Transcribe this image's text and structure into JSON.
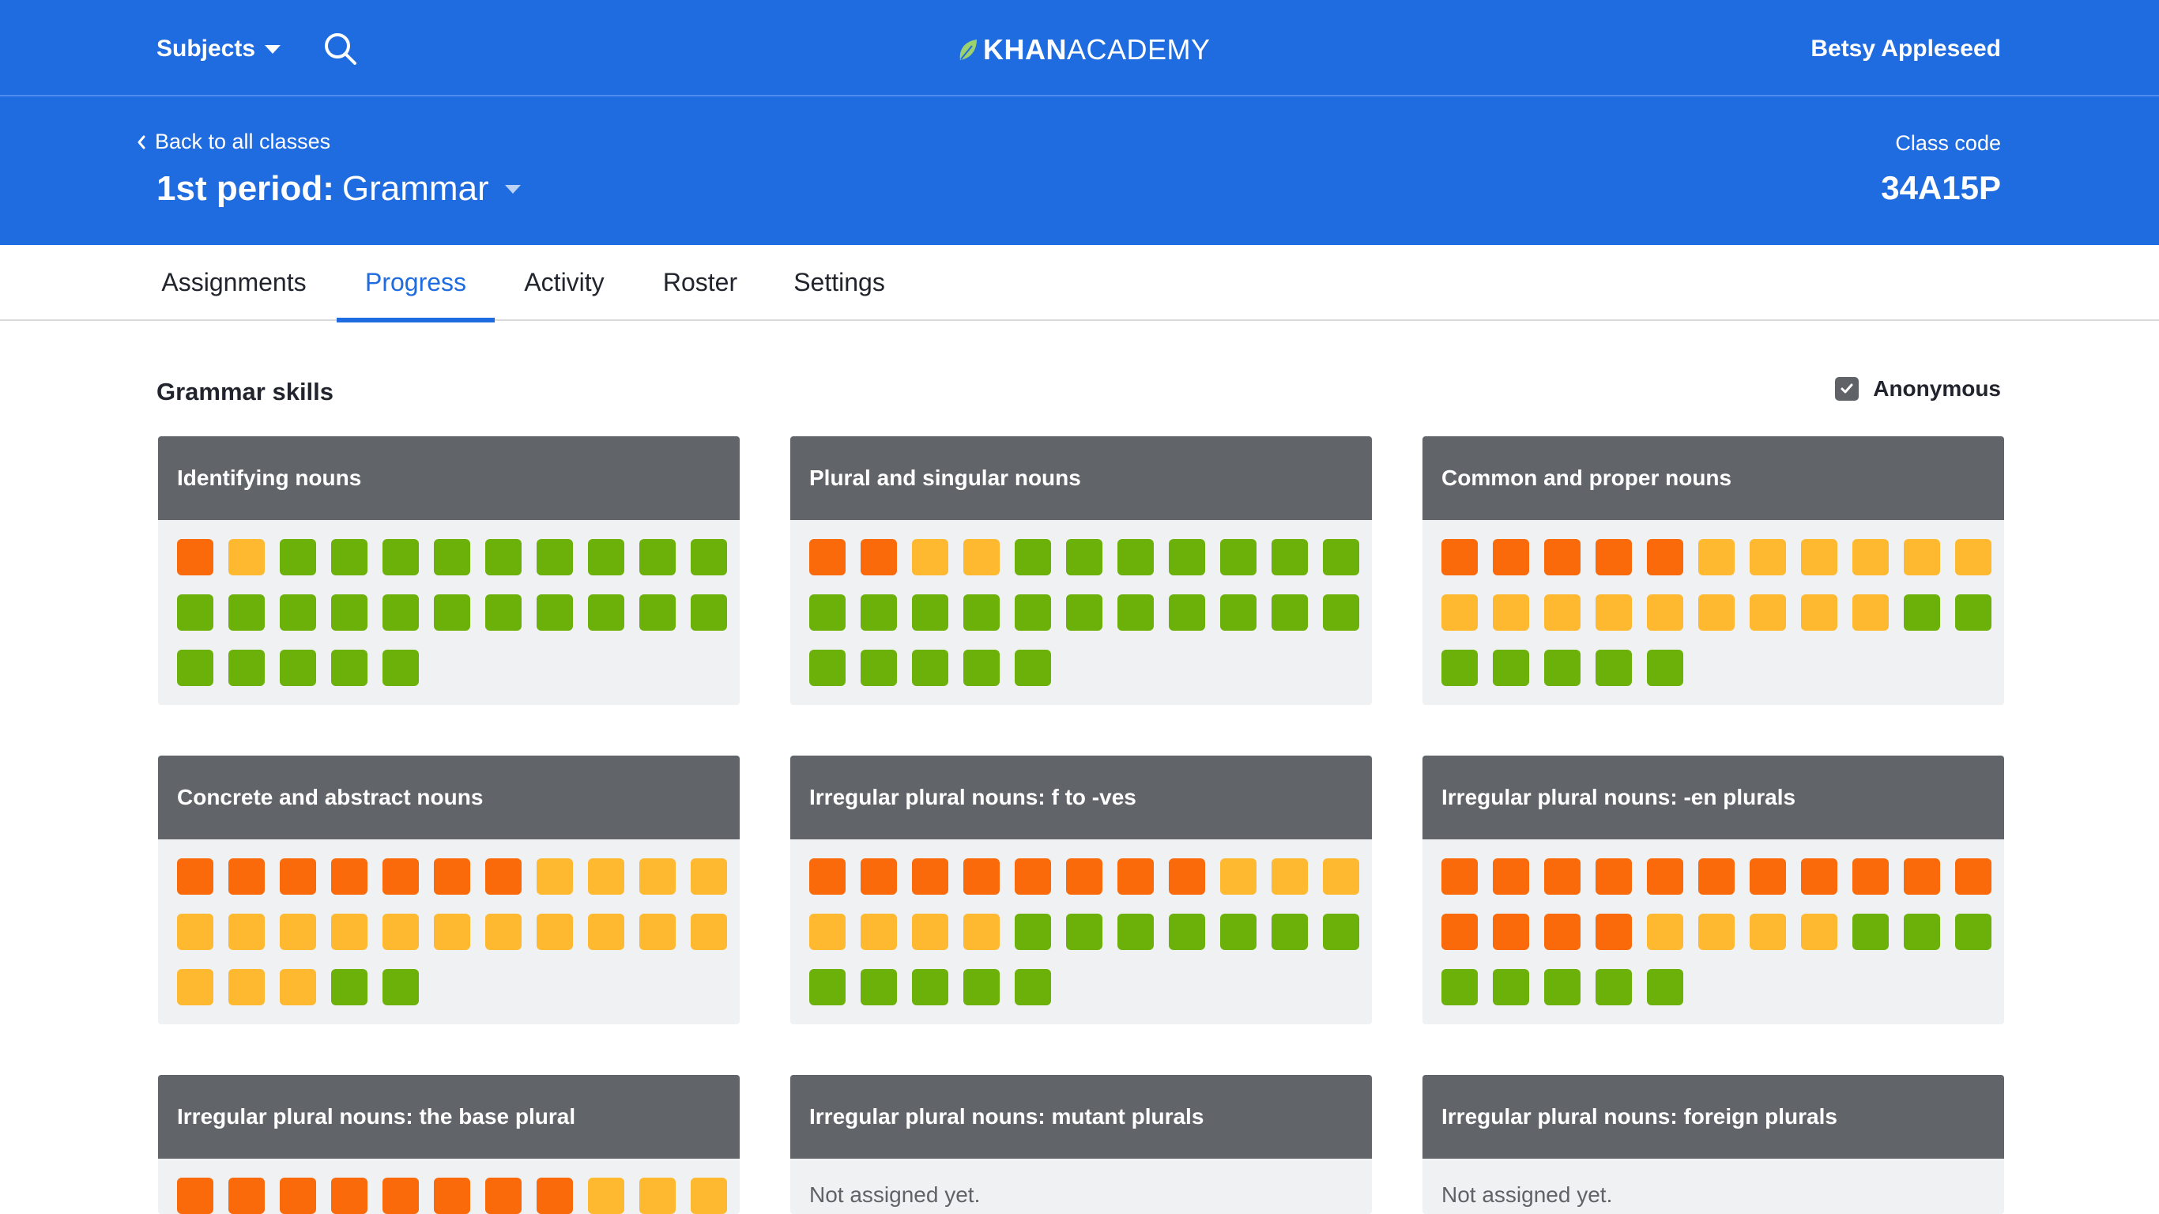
{
  "topnav": {
    "subjects_label": "Subjects",
    "logo_bold": "KHAN",
    "logo_light": "ACADEMY",
    "user_name": "Betsy Appleseed"
  },
  "classbar": {
    "back_label": "Back to all classes",
    "period": "1st period:",
    "class_name": "Grammar",
    "class_code_label": "Class code",
    "class_code": "34A15P"
  },
  "tabs": [
    {
      "label": "Assignments",
      "active": false
    },
    {
      "label": "Progress",
      "active": true
    },
    {
      "label": "Activity",
      "active": false
    },
    {
      "label": "Roster",
      "active": false
    },
    {
      "label": "Settings",
      "active": false
    }
  ],
  "section": {
    "title": "Grammar skills",
    "anonymous_label": "Anonymous",
    "anonymous_checked": true
  },
  "colors": {
    "brand_blue": "#1f6be0",
    "struggling": "#fa6a0a",
    "practiced": "#ffb931",
    "mastered": "#6bb10a"
  },
  "cards": [
    {
      "title": "Identifying nouns",
      "status": "",
      "counts": {
        "struggling": 1,
        "practiced": 1,
        "mastered": 25
      }
    },
    {
      "title": "Plural and singular nouns",
      "status": "",
      "counts": {
        "struggling": 2,
        "practiced": 2,
        "mastered": 23
      }
    },
    {
      "title": "Common and proper nouns",
      "status": "",
      "counts": {
        "struggling": 5,
        "practiced": 15,
        "mastered": 7
      }
    },
    {
      "title": "Concrete and abstract nouns",
      "status": "",
      "counts": {
        "struggling": 7,
        "practiced": 18,
        "mastered": 2
      }
    },
    {
      "title": "Irregular plural nouns: f to -ves",
      "status": "",
      "counts": {
        "struggling": 8,
        "practiced": 7,
        "mastered": 12
      }
    },
    {
      "title": "Irregular plural nouns: -en plurals",
      "status": "",
      "counts": {
        "struggling": 15,
        "practiced": 4,
        "mastered": 8
      }
    },
    {
      "title": "Irregular plural nouns: the base plural",
      "status": "",
      "counts": {
        "struggling": 8,
        "practiced": 3,
        "mastered": 0
      }
    },
    {
      "title": "Irregular plural nouns: mutant plurals",
      "status": "Not assigned yet.",
      "counts": null
    },
    {
      "title": "Irregular plural nouns: foreign plurals",
      "status": "Not assigned yet.",
      "counts": null
    }
  ]
}
